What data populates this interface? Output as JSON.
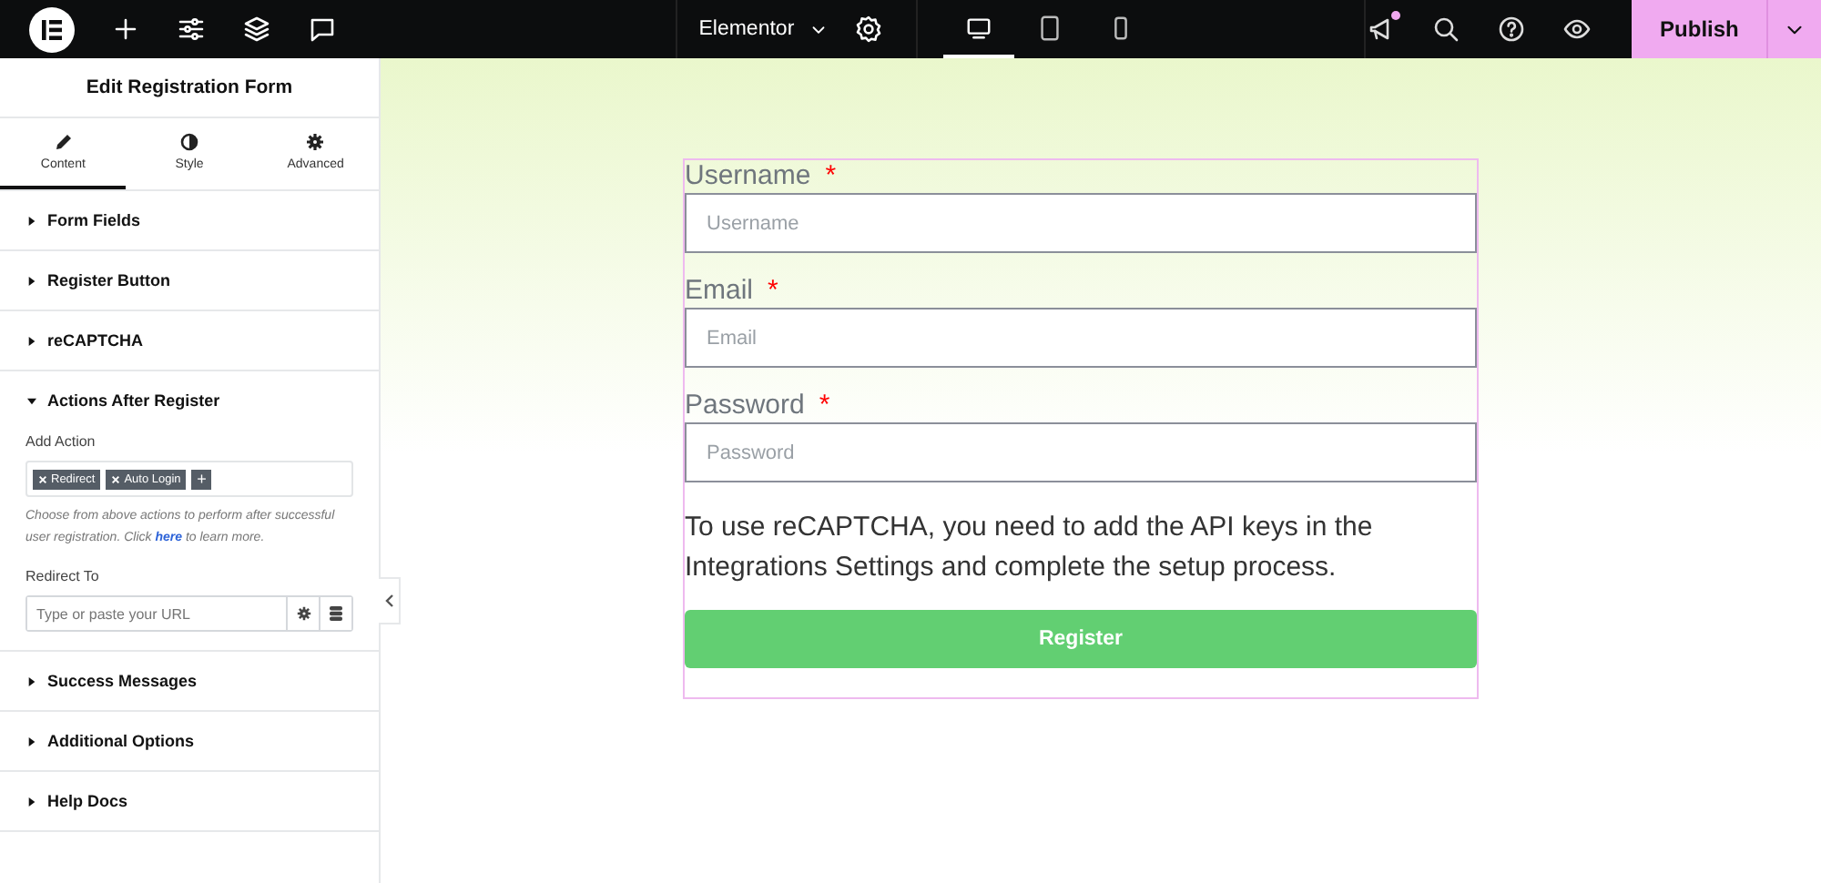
{
  "topbar": {
    "site_name": "Elementor",
    "devices": [
      {
        "kind": "desktop",
        "selected": true
      },
      {
        "kind": "tablet",
        "selected": false
      },
      {
        "kind": "mobile",
        "selected": false
      }
    ],
    "notification": true,
    "publish": "Publish"
  },
  "panel": {
    "title": "Edit Registration Form",
    "tabs": [
      {
        "label": "Content",
        "kind": "pencil",
        "selected": true
      },
      {
        "label": "Style",
        "kind": "contrast",
        "selected": false
      },
      {
        "label": "Advanced",
        "kind": "gear",
        "selected": false
      }
    ],
    "sections": [
      {
        "title": "Form Fields",
        "expanded": false
      },
      {
        "title": "Register Button",
        "expanded": false
      },
      {
        "title": "reCAPTCHA",
        "expanded": false
      },
      {
        "title": "Actions After Register",
        "expanded": true,
        "add_action_label": "Add Action",
        "tags": [
          "Redirect",
          "Auto Login"
        ],
        "add_tag": "+",
        "help_before": "Choose from above actions to perform after successful user registration. Click",
        "help_link": "here",
        "help_after": "to learn more.",
        "redirect_label": "Redirect To",
        "url_placeholder": "Type or paste your URL"
      },
      {
        "title": "Success Messages",
        "expanded": false
      },
      {
        "title": "Additional Options",
        "expanded": false
      },
      {
        "title": "Help Docs",
        "expanded": false
      }
    ]
  },
  "form": {
    "fields": [
      {
        "label": "Username",
        "required_mark": "*",
        "placeholder": "Username"
      },
      {
        "label": "Email",
        "required_mark": "*",
        "placeholder": "Email"
      },
      {
        "label": "Password",
        "required_mark": "*",
        "placeholder": "Password"
      }
    ],
    "notice": "To use reCAPTCHA, you need to add the API keys in the Integrations Settings and complete the setup process.",
    "button": "Register"
  }
}
